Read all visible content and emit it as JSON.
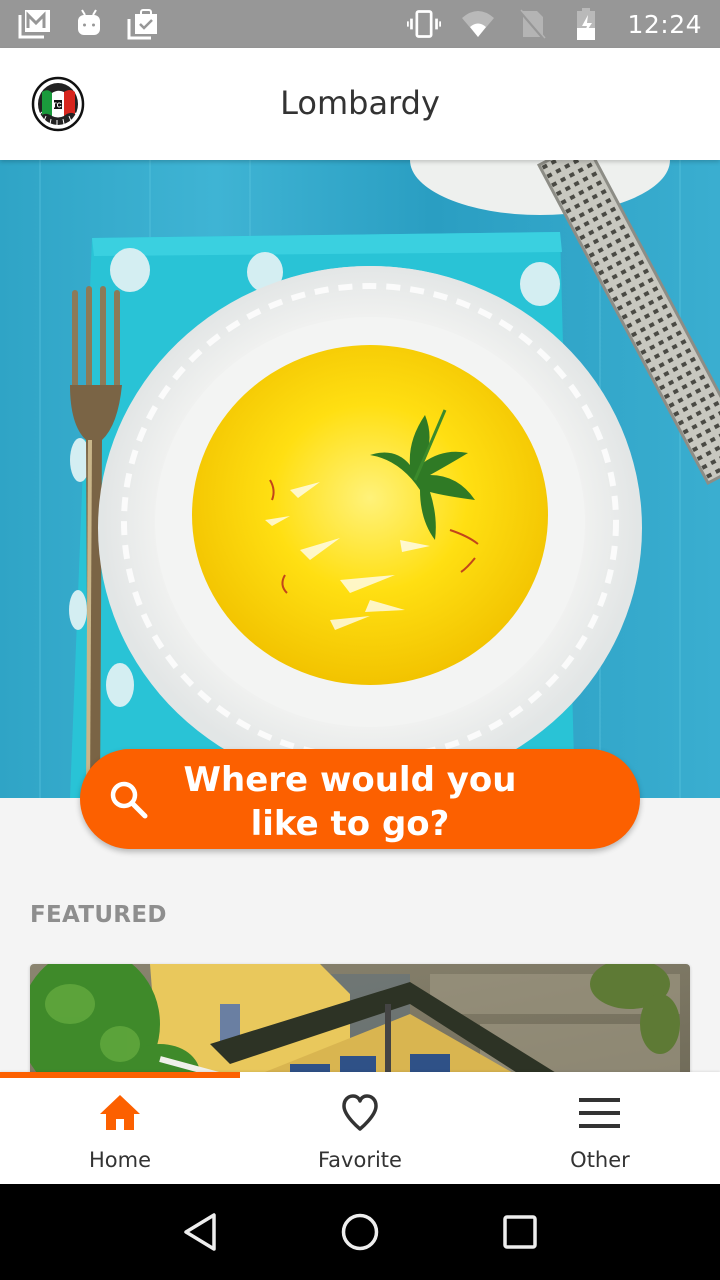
{
  "status_bar": {
    "left_icons": [
      "gmail-icon",
      "android-icon",
      "clipboard-check-icon"
    ],
    "right_icons": [
      "vibrate-icon",
      "wifi-icon",
      "no-sim-icon",
      "battery-charging-icon"
    ],
    "time": "12:24"
  },
  "app_bar": {
    "title": "Lombardy",
    "logo": "italy-flag-badge-logo"
  },
  "hero": {
    "image": "risotto-alla-milanese-photo"
  },
  "search": {
    "icon": "search-icon",
    "label": "Where would you like to go?",
    "color": "#fc6000"
  },
  "featured": {
    "heading": "FEATURED",
    "card_image": "yellow-villa-building-photo"
  },
  "bottom_nav": {
    "active_index": 0,
    "accent": "#fc6000",
    "items": [
      {
        "label": "Home",
        "icon": "home-icon"
      },
      {
        "label": "Favorite",
        "icon": "heart-icon"
      },
      {
        "label": "Other",
        "icon": "menu-icon"
      }
    ]
  },
  "system_nav": {
    "buttons": [
      "back-icon",
      "home-circle-icon",
      "recents-icon"
    ]
  }
}
